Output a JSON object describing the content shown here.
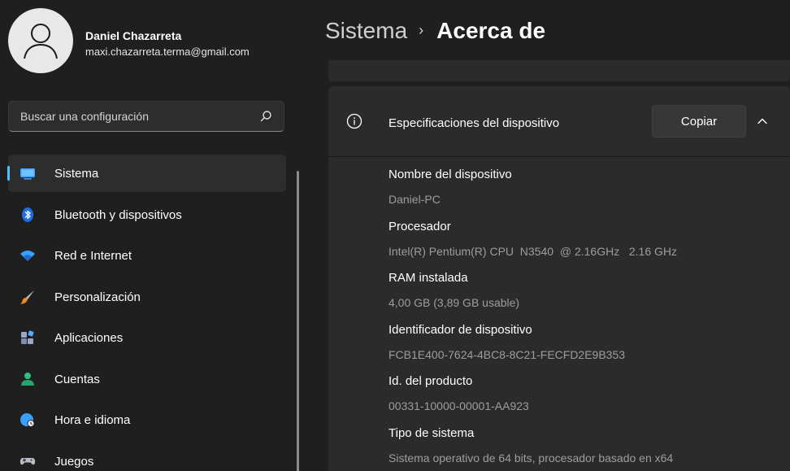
{
  "user": {
    "name": "Daniel Chazarreta",
    "email": "maxi.chazarreta.terma@gmail.com"
  },
  "search": {
    "placeholder": "Buscar una configuración"
  },
  "nav": {
    "items": [
      {
        "label": "Sistema",
        "icon": "monitor-icon",
        "active": true
      },
      {
        "label": "Bluetooth y dispositivos",
        "icon": "bluetooth-icon"
      },
      {
        "label": "Red e Internet",
        "icon": "wifi-icon"
      },
      {
        "label": "Personalización",
        "icon": "brush-icon"
      },
      {
        "label": "Aplicaciones",
        "icon": "apps-icon"
      },
      {
        "label": "Cuentas",
        "icon": "person-icon"
      },
      {
        "label": "Hora e idioma",
        "icon": "globe-clock-icon"
      },
      {
        "label": "Juegos",
        "icon": "gamepad-icon"
      }
    ]
  },
  "header": {
    "parent": "Sistema",
    "separator": "›",
    "current": "Acerca de"
  },
  "specs_card": {
    "title": "Especificaciones del dispositivo",
    "copy_label": "Copiar",
    "rows": [
      {
        "label": "Nombre del dispositivo",
        "value": "Daniel-PC"
      },
      {
        "label": "Procesador",
        "value": "Intel(R) Pentium(R) CPU  N3540  @ 2.16GHz   2.16 GHz"
      },
      {
        "label": "RAM instalada",
        "value": "4,00 GB (3,89 GB usable)"
      },
      {
        "label": "Identificador de dispositivo",
        "value": "FCB1E400-7624-4BC8-8C21-FECFD2E9B353"
      },
      {
        "label": "Id. del producto",
        "value": "00331-10000-00001-AA923"
      },
      {
        "label": "Tipo de sistema",
        "value": "Sistema operativo de 64 bits, procesador basado en x64"
      }
    ]
  },
  "colors": {
    "accent": "#4cc2ff",
    "background": "#1f1f1f",
    "card": "#2b2b2b",
    "secondary_text": "#9d9d9d"
  }
}
